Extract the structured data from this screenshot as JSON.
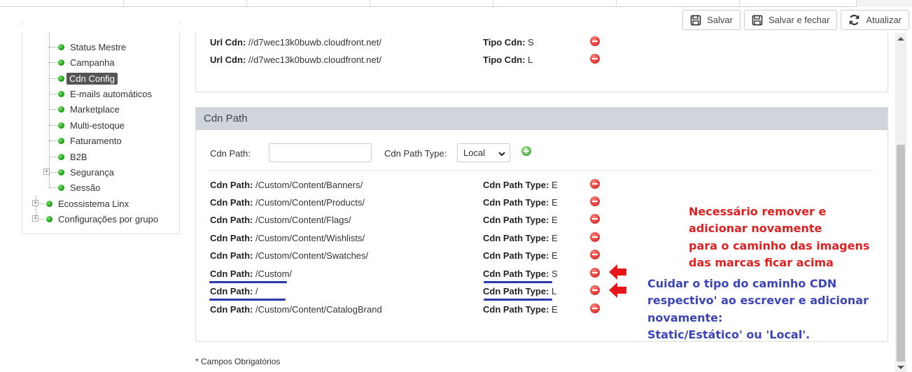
{
  "toolbar": {
    "save_label": "Salvar",
    "save_close_label": "Salvar e fechar",
    "refresh_label": "Atualizar"
  },
  "tree": {
    "items": [
      {
        "label": "Status Mestre"
      },
      {
        "label": "Campanha"
      },
      {
        "label": "Cdn Config",
        "selected": true
      },
      {
        "label": "E-mails automáticos"
      },
      {
        "label": "Marketplace"
      },
      {
        "label": "Multi-estoque"
      },
      {
        "label": "Faturamento"
      },
      {
        "label": "B2B"
      },
      {
        "label": "Segurança"
      },
      {
        "label": "Sessão"
      },
      {
        "label": "Ecossistema Linx"
      },
      {
        "label": "Configurações por grupo"
      }
    ]
  },
  "cdn_urls": [
    {
      "url_label": "Url Cdn:",
      "url_value": "//d7wec13k0buwb.cloudfront.net/",
      "type_label": "Tipo Cdn:",
      "type_value": "S"
    },
    {
      "url_label": "Url Cdn:",
      "url_value": "//d7wec13k0buwb.cloudfront.net/",
      "type_label": "Tipo Cdn:",
      "type_value": "L"
    }
  ],
  "cdn_path": {
    "panel_title": "Cdn Path",
    "path_label": "Cdn Path:",
    "path_value": "",
    "type_label": "Cdn Path Type:",
    "type_selected": "Local",
    "rows": [
      {
        "path_label": "Cdn Path:",
        "path_value": "/Custom/Content/Banners/",
        "type_label": "Cdn Path Type:",
        "type_value": "E"
      },
      {
        "path_label": "Cdn Path:",
        "path_value": "/Custom/Content/Products/",
        "type_label": "Cdn Path Type:",
        "type_value": "E"
      },
      {
        "path_label": "Cdn Path:",
        "path_value": "/Custom/Content/Flags/",
        "type_label": "Cdn Path Type:",
        "type_value": "E"
      },
      {
        "path_label": "Cdn Path:",
        "path_value": "/Custom/Content/Wishlists/",
        "type_label": "Cdn Path Type:",
        "type_value": "E"
      },
      {
        "path_label": "Cdn Path:",
        "path_value": "/Custom/Content/Swatches/",
        "type_label": "Cdn Path Type:",
        "type_value": "E"
      },
      {
        "path_label": "Cdn Path:",
        "path_value": "/Custom/",
        "type_label": "Cdn Path Type:",
        "type_value": "S"
      },
      {
        "path_label": "Cdn Path:",
        "path_value": "/",
        "type_label": "Cdn Path Type:",
        "type_value": "L"
      },
      {
        "path_label": "Cdn Path:",
        "path_value": "/Custom/Content/CatalogBrand",
        "type_label": "Cdn Path Type:",
        "type_value": "E"
      }
    ]
  },
  "annotations": {
    "red_lines": [
      "Necessário remover e",
      "adicionar novamente",
      "para o caminho das imagens",
      "das marcas ficar acima"
    ],
    "blue_lines": [
      "Cuidar o tipo do caminho CDN",
      "respectivo' ao escrever e adicionar",
      "novamente:",
      "Static/Estático' ou 'Local'."
    ]
  },
  "footer": {
    "required_note": "* Campos Obrigatórios"
  },
  "colors": {
    "panel_header": "#cfd5db",
    "annotation_red": "#e02020",
    "annotation_blue": "#3b44b8",
    "underline_blue": "#2b3aa8",
    "selected_tree_bg": "#555555"
  }
}
